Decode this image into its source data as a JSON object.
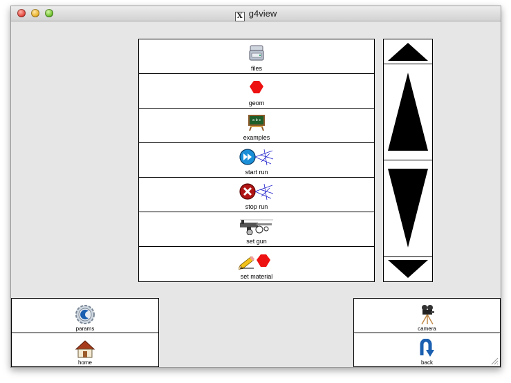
{
  "window": {
    "title": "g4view"
  },
  "menu": {
    "items": [
      {
        "label": "files",
        "icon": "drive-icon"
      },
      {
        "label": "geom",
        "icon": "red-hexagon-icon"
      },
      {
        "label": "examples",
        "icon": "chalkboard-icon"
      },
      {
        "label": "start run",
        "icon": "fast-forward-particle-icon"
      },
      {
        "label": "stop run",
        "icon": "stop-particle-icon"
      },
      {
        "label": "set gun",
        "icon": "particle-gun-icon"
      },
      {
        "label": "set material",
        "icon": "pencil-hexagon-icon"
      }
    ]
  },
  "scroll": {
    "up_icon": "scroll-up-icon",
    "page_up_icon": "page-up-icon",
    "page_down_icon": "page-down-icon",
    "down_icon": "scroll-down-icon"
  },
  "bottom_left": [
    {
      "label": "params",
      "icon": "gear-icon"
    },
    {
      "label": "home",
      "icon": "home-icon"
    }
  ],
  "bottom_right": [
    {
      "label": "camera",
      "icon": "camera-tripod-icon"
    },
    {
      "label": "back",
      "icon": "back-arrow-icon"
    }
  ],
  "colors": {
    "window_bg": "#e6e6e6",
    "button_bg": "#ffffff",
    "border": "#000000",
    "accent_red": "#ee1111",
    "accent_blue": "#1a8fd8"
  }
}
